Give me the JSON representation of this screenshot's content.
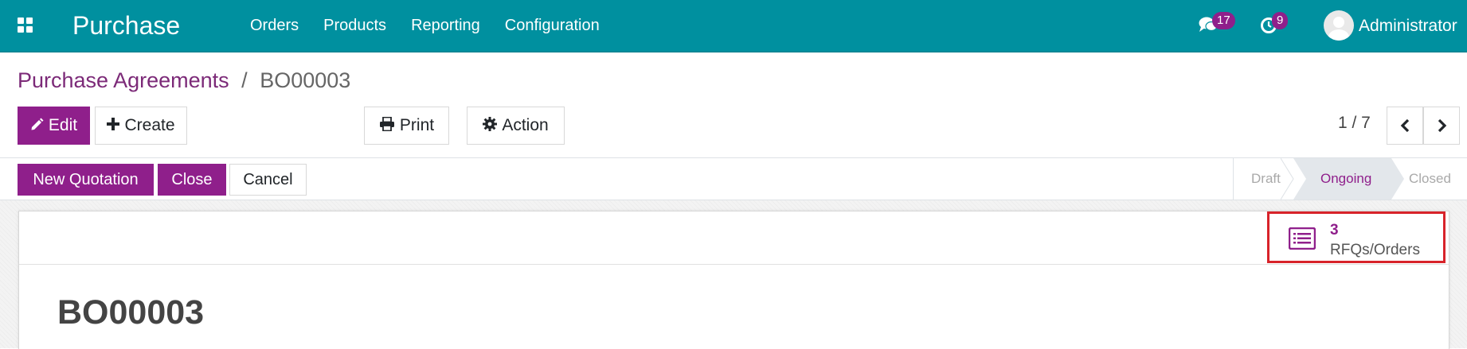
{
  "navbar": {
    "app_title": "Purchase",
    "menu": [
      "Orders",
      "Products",
      "Reporting",
      "Configuration"
    ],
    "messages_count": "17",
    "activities_count": "9",
    "user_name": "Administrator"
  },
  "breadcrumb": {
    "parent": "Purchase Agreements",
    "separator": "/",
    "current": "BO00003"
  },
  "toolbar": {
    "edit_label": "Edit",
    "create_label": "Create",
    "print_label": "Print",
    "action_label": "Action"
  },
  "pager": {
    "value": "1 / 7"
  },
  "status_buttons": {
    "new_quotation": "New Quotation",
    "close": "Close",
    "cancel": "Cancel"
  },
  "stages": [
    "Draft",
    "Ongoing",
    "Closed"
  ],
  "active_stage": "Ongoing",
  "smart_button": {
    "value": "3",
    "label": "RFQs/Orders"
  },
  "record": {
    "name": "BO00003"
  },
  "colors": {
    "navbar": "#00909f",
    "primary": "#8f1f8b",
    "breadcrumb_link": "#7c2a78",
    "highlight_border": "#d8232a"
  }
}
